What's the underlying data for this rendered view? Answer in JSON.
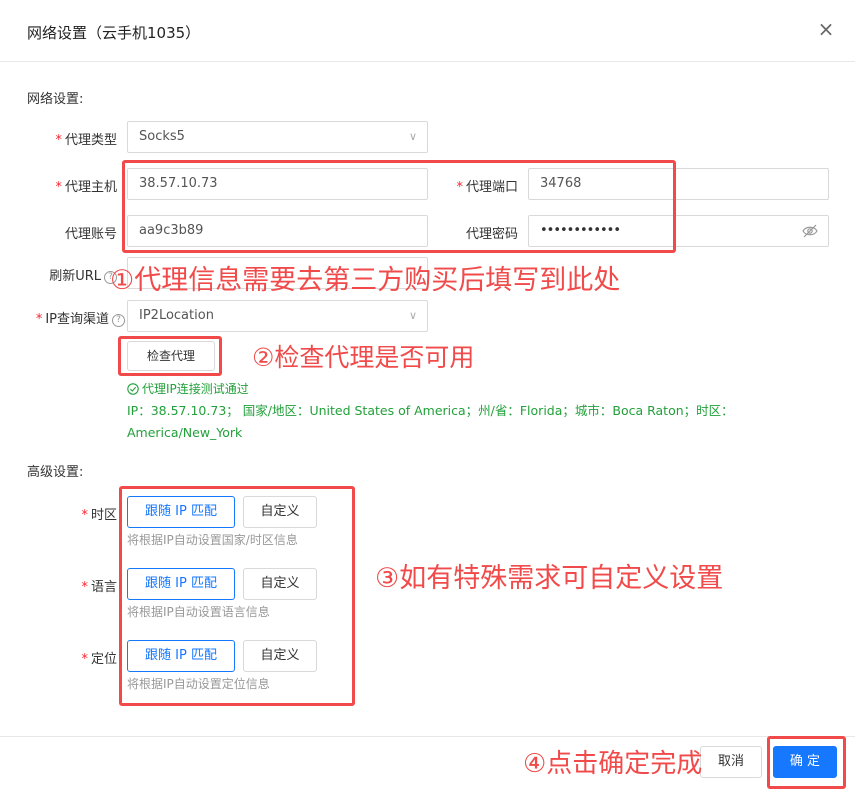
{
  "dialog": {
    "title": "网络设置（云手机1035）",
    "close_glyph": "×"
  },
  "network": {
    "section_label": "网络设置:",
    "proxy_type": {
      "label": "代理类型",
      "value": "Socks5"
    },
    "proxy_host": {
      "label": "代理主机",
      "value": "38.57.10.73"
    },
    "proxy_port": {
      "label": "代理端口",
      "value": "34768"
    },
    "proxy_account": {
      "label": "代理账号",
      "value": "aa9c3b89"
    },
    "proxy_password": {
      "label": "代理密码",
      "value": "••••••••••••"
    },
    "refresh_url": {
      "label": "刷新URL",
      "help": "?",
      "value": ""
    },
    "ip_channel": {
      "label": "IP查询渠道",
      "help": "?",
      "value": "IP2Location"
    },
    "check_button": "检查代理",
    "check_result_title": "代理IP连接测试通过",
    "check_result_detail": "IP：38.57.10.73；  国家/地区：United States of America；州/省：Florida；城市：Boca Raton；时区：America/New_York"
  },
  "advanced": {
    "section_label": "高级设置:",
    "timezone": {
      "label": "时区",
      "follow": "跟随 IP 匹配",
      "custom": "自定义",
      "hint": "将根据IP自动设置国家/时区信息"
    },
    "language": {
      "label": "语言",
      "follow": "跟随 IP 匹配",
      "custom": "自定义",
      "hint": "将根据IP自动设置语言信息"
    },
    "location": {
      "label": "定位",
      "follow": "跟随 IP 匹配",
      "custom": "自定义",
      "hint": "将根据IP自动设置定位信息"
    }
  },
  "footer": {
    "cancel": "取消",
    "confirm": "确 定"
  },
  "annotations": {
    "a1": "①代理信息需要去第三方购买后填写到此处",
    "a2": "②检查代理是否可用",
    "a3": "③如有特殊需求可自定义设置",
    "a4": "④点击确定完成"
  },
  "colors": {
    "primary": "#1677ff",
    "annotation": "#f04a4a",
    "success": "#22a03a",
    "required": "#f5222d"
  }
}
